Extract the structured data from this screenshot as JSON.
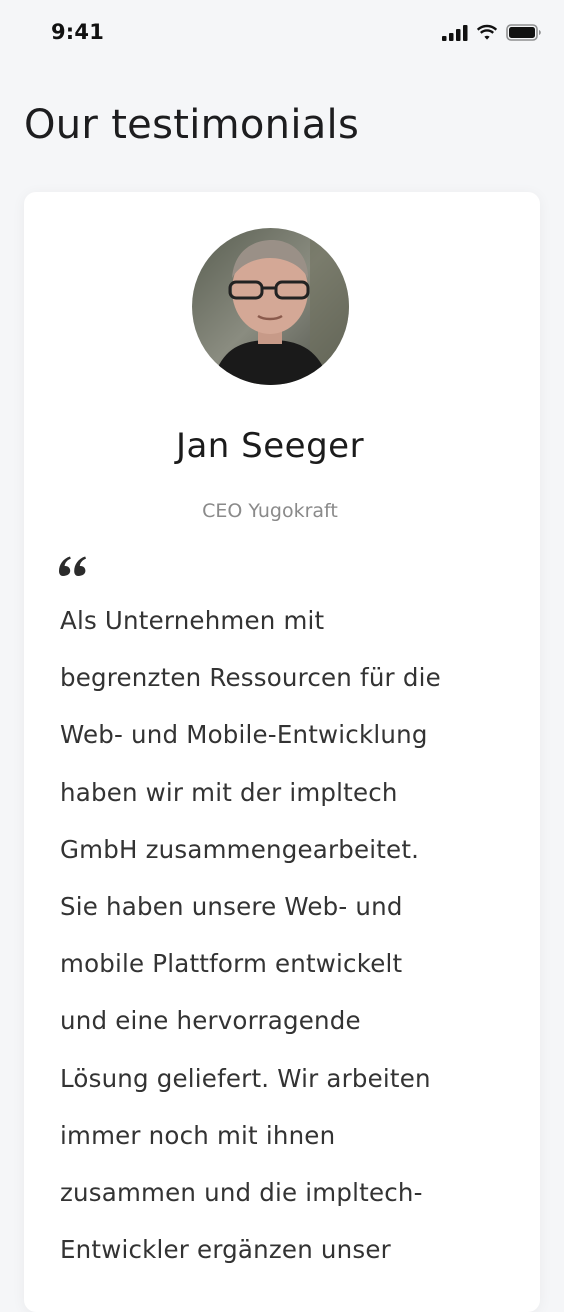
{
  "status_bar": {
    "time": "9:41",
    "icons": [
      "cellular-signal-icon",
      "wifi-icon",
      "battery-icon"
    ]
  },
  "page": {
    "title": "Our testimonials"
  },
  "testimonial": {
    "name": "Jan Seeger",
    "role": "CEO Yugokraft",
    "quote_lines": [
      "Als Unternehmen mit",
      "begrenzten Ressourcen für die",
      "Web- und Mobile-Entwicklung",
      "haben wir mit der impltech",
      "GmbH zusammengearbeitet.",
      "Sie haben unsere Web- und",
      "mobile Plattform entwickelt",
      "und eine hervorragende",
      "Lösung geliefert. Wir arbeiten",
      "immer noch mit ihnen",
      "zusammen und die impltech-",
      "Entwickler ergänzen unser"
    ]
  },
  "colors": {
    "background": "#f5f6f8",
    "card": "#ffffff",
    "title": "#1d1d1f",
    "role": "#8a8a8a",
    "body_text": "#333333"
  }
}
